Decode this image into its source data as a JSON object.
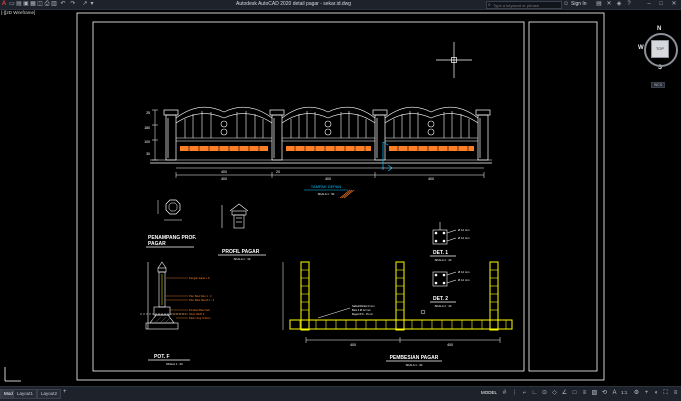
{
  "app": {
    "title": "Autodesk AutoCAD 2020   detail pagar - sekar.id.dwg",
    "search_placeholder": "Type a keyword or phrase",
    "sign_in": "Sign In",
    "viewport_label": "[-][2D Wireframe]"
  },
  "viewcube": {
    "face": "TOP",
    "north": "N",
    "south": "S",
    "east": "",
    "west": "W",
    "wcs": "WCS"
  },
  "drawing": {
    "elevation_title": "TAMPAK DEPAN",
    "elevation_scale": "SKALA 1 : 50",
    "dims_bottom": [
      "20",
      "400",
      "20",
      "400",
      "400",
      "20"
    ],
    "left_dims": [
      "25",
      "180",
      "100",
      "30",
      "25"
    ],
    "section_title_1": "PENAMPANG PROF.",
    "section_title_2": "PAGAR",
    "profile_title": "PROFIL PAGAR",
    "profile_scale": "SKALA 1 : 10",
    "pot_title": "POT. F",
    "pot_scale": "SKALA 1 : 20",
    "pot_notes": [
      "Dengan kapal + 8",
      "Plat. Besi Siku 1 : 3",
      "Plat. Batu Merah 1 : 3",
      "Pondasi Batu Kali",
      "Sloof 15/20 3",
      "Pasir Urug t=10cm"
    ],
    "det1_title": "DET. 1",
    "det2_title": "DET. 2",
    "det_scale": "SKALA 1 : 10",
    "det_notes": [
      "Ø 12 mm",
      "Ø 12 mm",
      "Ø 12 mm",
      "Ø 12 mm"
    ],
    "rebar_title": "PEMBESIAN PAGAR",
    "rebar_scale": "SKALA 1 : 20",
    "rebar_notes": [
      "Sabuk/Dinkel 3 mm",
      "Besi 4 Ø 12 mm",
      "Begel Ø 6 - 15 cm"
    ],
    "rebar_dims": [
      "400",
      "400"
    ]
  },
  "status": {
    "model_tab": "Model",
    "layout1": "Layout1",
    "layout2": "Layout2",
    "model_space": "MODEL",
    "zoom": "1:1"
  },
  "colors": {
    "background": "#000000",
    "accent_yellow": "#ffff00",
    "accent_orange": "#ff7f27",
    "accent_cyan": "#00bfff",
    "frame": "#ffffff"
  }
}
